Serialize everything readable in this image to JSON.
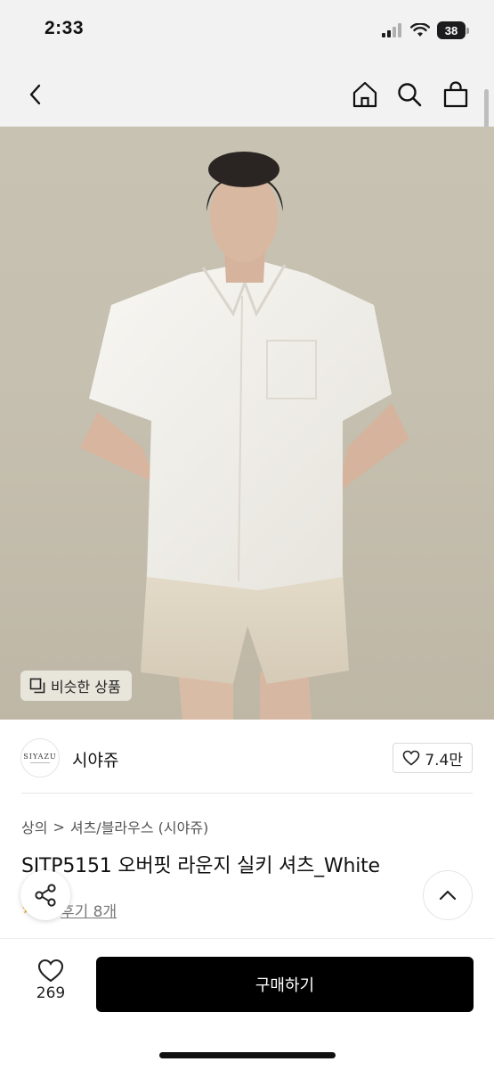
{
  "status_bar": {
    "time": "2:33",
    "battery": "38"
  },
  "nav": {
    "back_icon": "chevron-left-icon",
    "home_icon": "home-icon",
    "search_icon": "search-icon",
    "cart_icon": "shopping-bag-icon"
  },
  "hero": {
    "similar_label": "비슷한 상품"
  },
  "brand": {
    "logo_text": "SIYAZU",
    "name": "시야쥬",
    "likes": "7.4만"
  },
  "breadcrumb": {
    "level1": "상의",
    "separator": ">",
    "level2": "셔츠/블라우스 (시야쥬)"
  },
  "product": {
    "title": "SITP5151 오버핏 라운지 실키 셔츠_White",
    "reviews": "후기 8개"
  },
  "bottom_bar": {
    "wish_count": "269",
    "buy_label": "구매하기"
  },
  "colors": {
    "accent": "#000000",
    "background_bar": "#f2f2f2",
    "star": "#f5a623"
  }
}
